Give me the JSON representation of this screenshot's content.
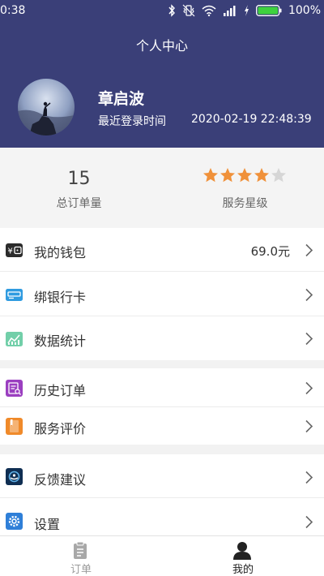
{
  "statusbar": {
    "time": "0:38",
    "battery": "100%"
  },
  "header": {
    "title": "个人中心",
    "user_name": "章启波",
    "login_label": "最近登录时间",
    "login_time": "2020-02-19 22:48:39"
  },
  "stats": {
    "order_count": "15",
    "order_count_label": "总订单量",
    "rating": 4,
    "rating_max": 5,
    "rating_label": "服务星级"
  },
  "menu": {
    "wallet": {
      "label": "我的钱包",
      "value": "69.0元",
      "icon": "wallet-icon"
    },
    "bank_card": {
      "label": "绑银行卡",
      "icon": "bank-card-icon"
    },
    "statistics": {
      "label": "数据统计",
      "icon": "chart-icon"
    },
    "order_history": {
      "label": "历史订单",
      "icon": "history-order-icon"
    },
    "service_review": {
      "label": "服务评价",
      "icon": "review-icon"
    },
    "feedback": {
      "label": "反馈建议",
      "icon": "feedback-icon"
    },
    "settings": {
      "label": "设置",
      "icon": "settings-icon"
    }
  },
  "tabbar": {
    "orders": {
      "label": "订单",
      "icon": "clipboard-icon"
    },
    "mine": {
      "label": "我的",
      "icon": "user-icon"
    }
  },
  "colors": {
    "header_bg": "#3a3f78",
    "star_active": "#f0913a",
    "star_inactive": "#d6d6d6",
    "tab_active": "#222222",
    "tab_inactive": "#9a9a9a"
  }
}
